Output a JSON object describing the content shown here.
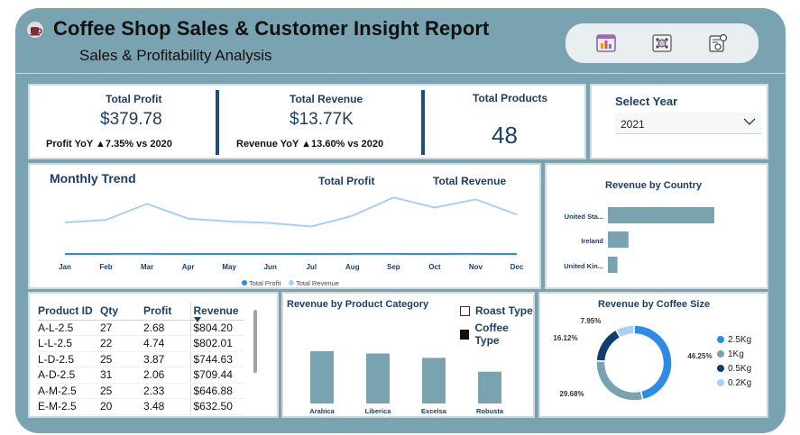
{
  "header": {
    "title": "Coffee Shop Sales & Customer Insight Report",
    "subtitle": "Sales & Profitability Analysis",
    "nav_icons": [
      "dashboard-icon",
      "coffee-beans-icon",
      "customer-report-icon"
    ]
  },
  "kpis": {
    "profit": {
      "label": "Total Profit",
      "value": "$379.78",
      "yoy": "Profit YoY ▲7.35% vs 2020"
    },
    "revenue": {
      "label": "Total Revenue",
      "value": "$13.77K",
      "yoy": "Revenue YoY ▲13.60% vs 2020"
    },
    "products": {
      "label": "Total Products",
      "value": "48"
    }
  },
  "year_filter": {
    "label": "Select Year",
    "value": "2021"
  },
  "monthly_trend": {
    "title": "Monthly Trend",
    "header_labels": [
      "Total Profit",
      "Total Revenue"
    ],
    "legend": [
      "Total Profit",
      "Total Revenue"
    ]
  },
  "country_chart": {
    "title": "Revenue by Country"
  },
  "product_table": {
    "columns": [
      "Product ID",
      "Qty",
      "Profit",
      "Revenue"
    ],
    "rows": [
      [
        "A-L-2.5",
        "27",
        "2.68",
        "$804.20"
      ],
      [
        "L-L-2.5",
        "22",
        "4.74",
        "$802.01"
      ],
      [
        "L-D-2.5",
        "25",
        "3.87",
        "$744.63"
      ],
      [
        "A-D-2.5",
        "31",
        "2.06",
        "$709.44"
      ],
      [
        "A-M-2.5",
        "25",
        "2.33",
        "$646.88"
      ],
      [
        "E-M-2.5",
        "20",
        "3.48",
        "$632.50"
      ]
    ]
  },
  "category_chart": {
    "title": "Revenue by Product Category",
    "filters": [
      {
        "label": "Roast Type",
        "checked": false
      },
      {
        "label": "Coffee Type",
        "checked": true
      }
    ]
  },
  "size_chart": {
    "title": "Revenue by Coffee Size"
  },
  "colors": {
    "frame": "#7aa3b1",
    "accent_dark": "#1d3f63",
    "bar": "#7aa3b1",
    "profit_line": "#2b8be6",
    "revenue_line": "#a8cff4"
  },
  "chart_data": [
    {
      "type": "line",
      "title": "Monthly Trend",
      "categories": [
        "Jan",
        "Feb",
        "Mar",
        "Apr",
        "May",
        "Jun",
        "Jul",
        "Aug",
        "Sep",
        "Oct",
        "Nov",
        "Dec"
      ],
      "series": [
        {
          "name": "Total Profit",
          "values": [
            28,
            30,
            32,
            29,
            27,
            30,
            28,
            31,
            33,
            30,
            32,
            29
          ]
        },
        {
          "name": "Total Revenue",
          "values": [
            1030,
            1110,
            1620,
            1150,
            1060,
            1010,
            900,
            1240,
            1820,
            1500,
            1760,
            1280
          ]
        }
      ],
      "legend": "bottom"
    },
    {
      "type": "bar",
      "orientation": "horizontal",
      "title": "Revenue by Country",
      "categories": [
        "United Sta...",
        "Ireland",
        "United Kin..."
      ],
      "values": [
        10600,
        2050,
        950
      ]
    },
    {
      "type": "bar",
      "title": "Revenue by Product Category",
      "categories": [
        "Arabica",
        "Liberica",
        "Excelsa",
        "Robusta"
      ],
      "values": [
        3700,
        3540,
        3230,
        2250
      ]
    },
    {
      "type": "pie",
      "title": "Revenue by Coffee Size",
      "labels": [
        "2.5Kg",
        "1Kg",
        "0.5Kg",
        "0.2Kg"
      ],
      "values": [
        46.25,
        29.68,
        16.12,
        7.95
      ],
      "value_labels": [
        "46.25%",
        "29.68%",
        "16.12%",
        "7.95%"
      ],
      "colors": [
        "#2b8be6",
        "#7aa3b1",
        "#0f3d6e",
        "#a8cff4"
      ],
      "legend": "right"
    }
  ]
}
